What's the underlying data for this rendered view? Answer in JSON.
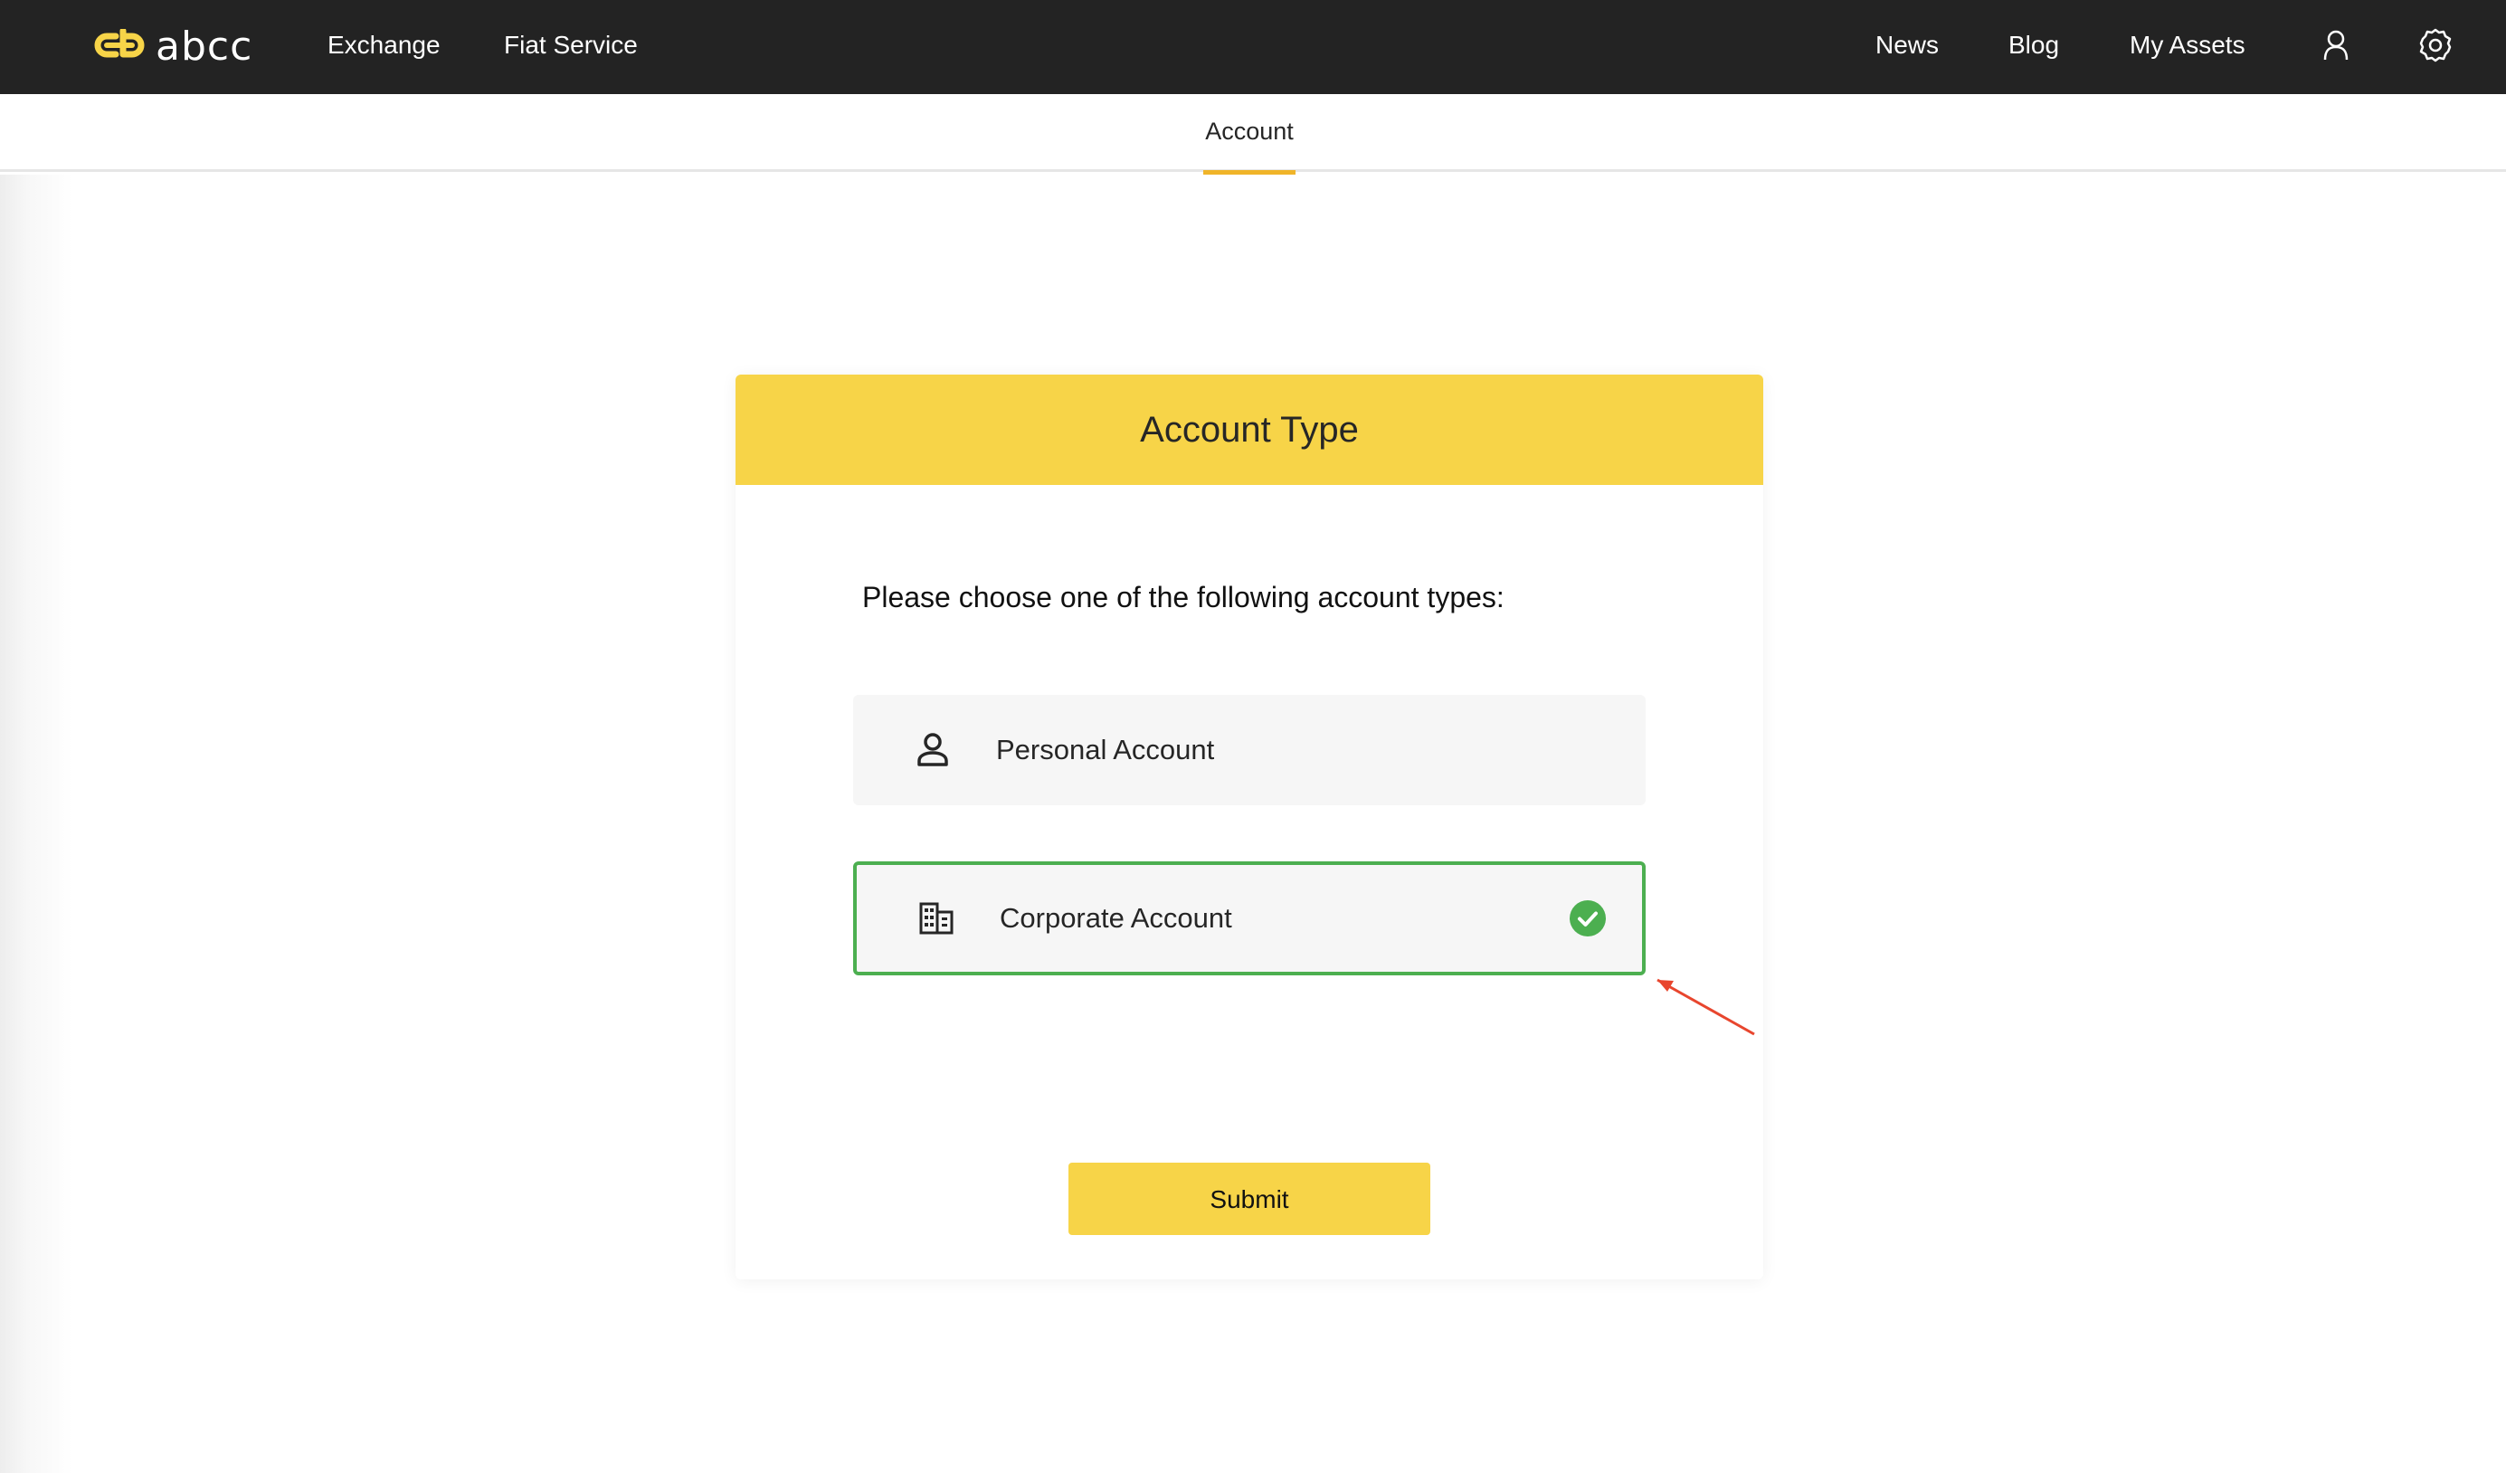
{
  "brand": {
    "name": "abcc",
    "accent_color": "#f7d448",
    "underline_color": "#f0b429",
    "topbar_color": "#232323"
  },
  "topnav": {
    "left_links": [
      {
        "label": "Exchange"
      },
      {
        "label": "Fiat Service"
      }
    ],
    "right_links": [
      {
        "label": "News"
      },
      {
        "label": "Blog"
      },
      {
        "label": "My Assets"
      }
    ],
    "icons": [
      "user-icon",
      "settings-gear-icon"
    ]
  },
  "subnav": {
    "active_tab": "Account"
  },
  "account_type_card": {
    "title": "Account Type",
    "prompt": "Please choose one of the following account types:",
    "options": [
      {
        "label": "Personal Account",
        "icon": "person-icon",
        "selected": false
      },
      {
        "label": "Corporate Account",
        "icon": "building-icon",
        "selected": true
      }
    ],
    "selected_color": "#4caf50",
    "submit_label": "Submit"
  },
  "annotation": {
    "type": "red-arrow",
    "color": "#e8462e",
    "points_to": "Corporate Account"
  }
}
